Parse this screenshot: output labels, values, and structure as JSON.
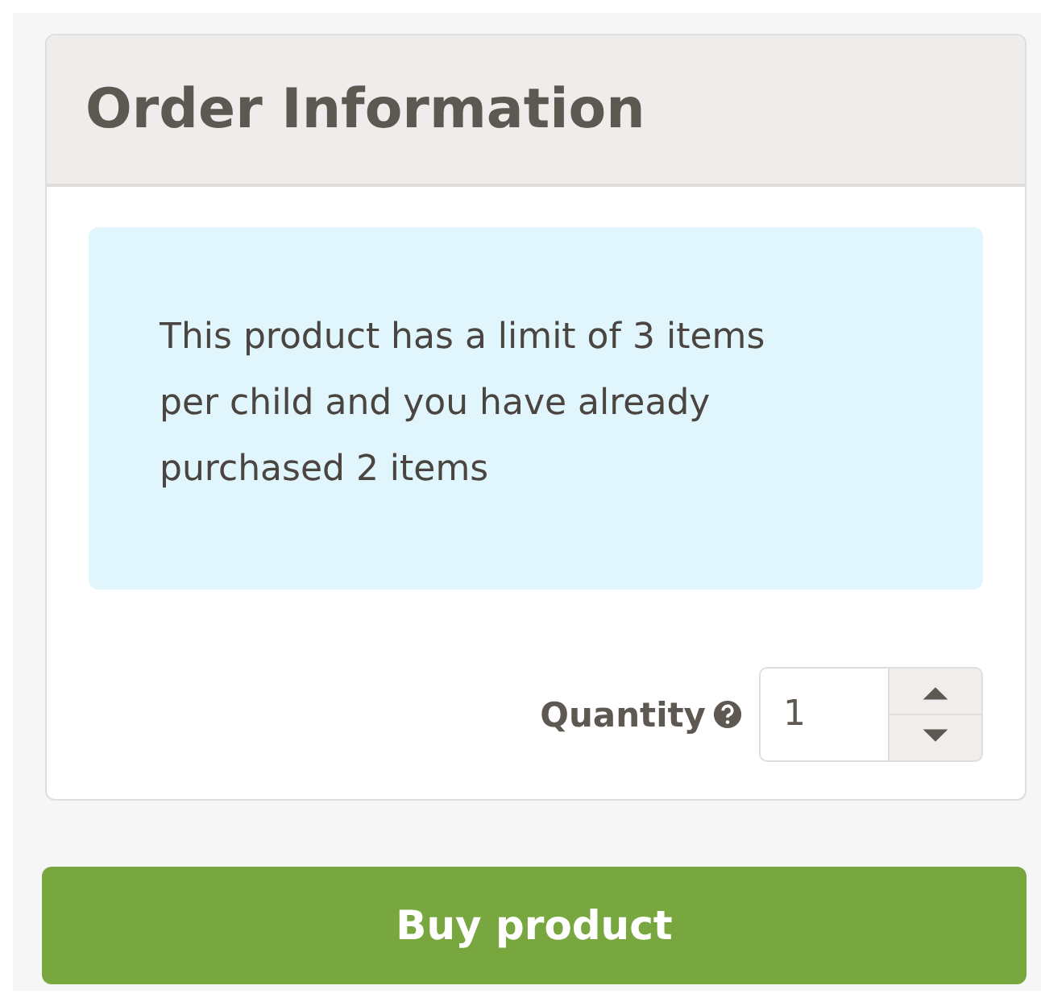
{
  "panel": {
    "title": "Order Information",
    "notice": "This product has a limit of 3 items per child and you have already purchased 2 items",
    "quantity": {
      "label": "Quantity",
      "value": "1"
    }
  },
  "buy_button": "Buy product"
}
